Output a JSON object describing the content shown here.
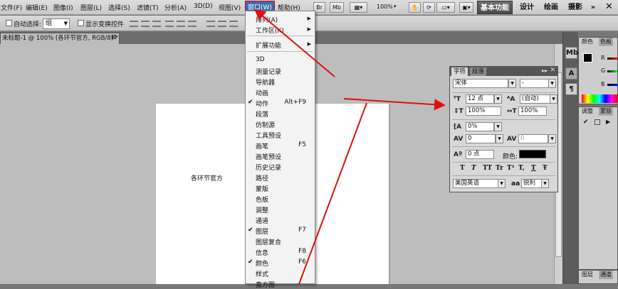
{
  "menubar": {
    "items": [
      "文件(F)",
      "编辑(E)",
      "图像(I)",
      "图层(L)",
      "选择(S)",
      "滤镜(T)",
      "分析(A)",
      "3D(D)",
      "视图(V)",
      "窗口(W)",
      "帮助(H)"
    ],
    "toolbar_buttons": [
      "Br",
      "Mb"
    ],
    "zoom": "100%",
    "workspaces": [
      "基本功能",
      "设计",
      "绘画",
      "摄影"
    ],
    "overflow": "»"
  },
  "options_bar": {
    "auto_select_label": "自动选择:",
    "auto_select_value": "组",
    "show_transform_label": "显示变换控件"
  },
  "document": {
    "tab_title": "未标题-1 @ 100% (各环节官方, RGB/8) *",
    "text_content": "各环节官方"
  },
  "window_menu": {
    "items": [
      {
        "label": "排列(A)",
        "shortcut": "",
        "submenu": true,
        "checked": false
      },
      {
        "label": "工作区(K)",
        "shortcut": "",
        "submenu": true,
        "checked": false
      },
      {
        "label": "扩展功能",
        "shortcut": "",
        "submenu": true,
        "checked": false
      },
      {
        "label": "3D",
        "shortcut": "",
        "submenu": false,
        "checked": false
      },
      {
        "label": "测量记录",
        "shortcut": "",
        "submenu": false,
        "checked": false
      },
      {
        "label": "导航器",
        "shortcut": "",
        "submenu": false,
        "checked": false
      },
      {
        "label": "动画",
        "shortcut": "",
        "submenu": false,
        "checked": false
      },
      {
        "label": "动作",
        "shortcut": "Alt+F9",
        "submenu": false,
        "checked": true
      },
      {
        "label": "段落",
        "shortcut": "",
        "submenu": false,
        "checked": false
      },
      {
        "label": "仿制源",
        "shortcut": "",
        "submenu": false,
        "checked": false
      },
      {
        "label": "工具预设",
        "shortcut": "",
        "submenu": false,
        "checked": false
      },
      {
        "label": "画笔",
        "shortcut": "F5",
        "submenu": false,
        "checked": false
      },
      {
        "label": "画笔预设",
        "shortcut": "",
        "submenu": false,
        "checked": false
      },
      {
        "label": "历史记录",
        "shortcut": "",
        "submenu": false,
        "checked": false
      },
      {
        "label": "路径",
        "shortcut": "",
        "submenu": false,
        "checked": false
      },
      {
        "label": "蒙版",
        "shortcut": "",
        "submenu": false,
        "checked": false
      },
      {
        "label": "色板",
        "shortcut": "",
        "submenu": false,
        "checked": false
      },
      {
        "label": "调整",
        "shortcut": "",
        "submenu": false,
        "checked": false
      },
      {
        "label": "通道",
        "shortcut": "",
        "submenu": false,
        "checked": false
      },
      {
        "label": "图层",
        "shortcut": "F7",
        "submenu": false,
        "checked": true
      },
      {
        "label": "图层复合",
        "shortcut": "",
        "submenu": false,
        "checked": false
      },
      {
        "label": "信息",
        "shortcut": "F8",
        "submenu": false,
        "checked": false
      },
      {
        "label": "颜色",
        "shortcut": "F6",
        "submenu": false,
        "checked": true
      },
      {
        "label": "样式",
        "shortcut": "",
        "submenu": false,
        "checked": false
      },
      {
        "label": "直方图",
        "shortcut": "",
        "submenu": false,
        "checked": false
      }
    ]
  },
  "character_panel": {
    "tabs": [
      "字符",
      "段落"
    ],
    "font_family": "宋体",
    "font_style": "-",
    "font_size": "12 点",
    "leading": "(自动)",
    "vertical_scale": "100%",
    "horizontal_scale": "100%",
    "tsume": "0%",
    "tracking": "0",
    "kerning": "0",
    "baseline_shift": "0 点",
    "color_label": "颜色:",
    "color_value": "#000000",
    "style_buttons": [
      "T",
      "T",
      "TT",
      "Tr",
      "T¹",
      "T,",
      "T",
      "Ŧ"
    ],
    "language": "美国英语",
    "aa_label": "aa",
    "antialias": "锐利"
  },
  "right_panels": {
    "color_tabs": [
      "颜色",
      "色板"
    ],
    "color_channels": [
      "R",
      "G",
      "B"
    ],
    "adjust_tabs": [
      "调整",
      "蒙版"
    ],
    "layer_tabs": [
      "图层",
      "通道"
    ]
  },
  "colors": {
    "menu_highlight": "#3a6fb0",
    "annotation_arrow": "#e01010"
  }
}
